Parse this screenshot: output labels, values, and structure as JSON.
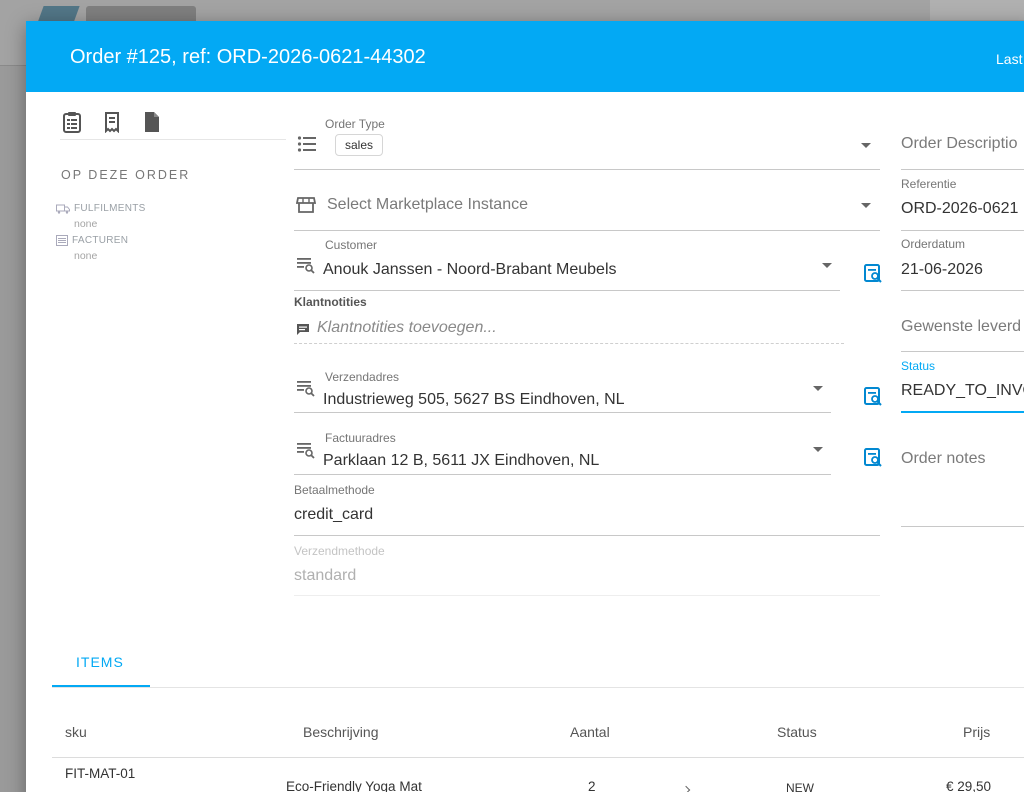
{
  "dialog": {
    "title": "Order #125, ref: ORD-2026-0621-44302",
    "header_right": "Last"
  },
  "left_panel": {
    "heading": "OP DEZE ORDER",
    "fulfilments_label": "FULFILMENTS",
    "fulfilments_value": "none",
    "facturen_label": "FACTUREN",
    "facturen_value": "none"
  },
  "form": {
    "order_type_label": "Order Type",
    "order_type_value": "sales",
    "marketplace_placeholder": "Select Marketplace Instance",
    "customer_label": "Customer",
    "customer_value": "Anouk Janssen - Noord-Brabant Meubels",
    "notes_title": "Klantnotities",
    "notes_placeholder": "Klantnotities toevoegen...",
    "shipping_label": "Verzendadres",
    "shipping_value": "Industrieweg 505, 5627 BS Eindhoven, NL",
    "billing_label": "Factuuradres",
    "billing_value": "Parklaan 12 B, 5611 JX Eindhoven, NL",
    "payment_label": "Betaalmethode",
    "payment_value": "credit_card",
    "shipping_method_label": "Verzendmethode",
    "shipping_method_value": "standard"
  },
  "right_col": {
    "description_placeholder": "Order Descriptio",
    "reference_label": "Referentie",
    "reference_value": "ORD-2026-0621",
    "order_date_label": "Orderdatum",
    "order_date_value": "21-06-2026",
    "desired_delivery_placeholder": "Gewenste leverd",
    "status_label": "Status",
    "status_value": "READY_TO_INVO",
    "order_notes_placeholder": "Order notes"
  },
  "tabs": {
    "items": "ITEMS"
  },
  "table": {
    "headers": [
      "sku",
      "Beschrijving",
      "Aantal",
      "Status",
      "Prijs"
    ],
    "rows": [
      {
        "sku": "FIT-MAT-01",
        "description": "Eco-Friendly Yoga Mat",
        "quantity": "2",
        "status": "NEW",
        "price": "€ 29,50"
      }
    ]
  },
  "colors": {
    "accent": "#03a9f4",
    "header_text": "#ffffff"
  }
}
